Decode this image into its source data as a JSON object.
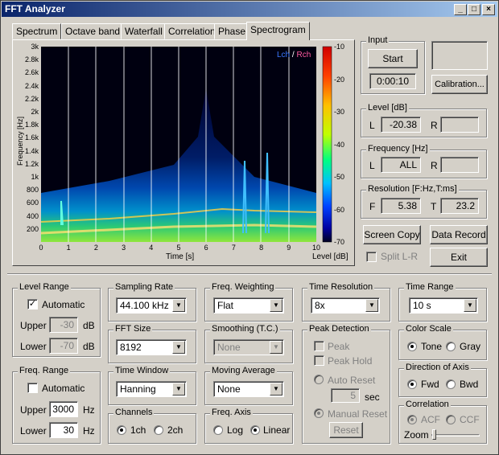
{
  "window": {
    "title": "FFT Analyzer",
    "controls": [
      "_",
      "□",
      "×"
    ]
  },
  "tabs": [
    "Spectrum",
    "Octave band",
    "Waterfall",
    "Correlation",
    "Phase",
    "Spectrogram"
  ],
  "active_tab": "Spectrogram",
  "spectrogram": {
    "y_ticks": [
      "3k",
      "2.8k",
      "2.6k",
      "2.4k",
      "2.2k",
      "2k",
      "1.8k",
      "1.6k",
      "1.4k",
      "1.2k",
      "1k",
      "800",
      "600",
      "400",
      "200"
    ],
    "x_ticks": [
      "0",
      "1",
      "2",
      "3",
      "4",
      "5",
      "6",
      "7",
      "8",
      "9",
      "10"
    ],
    "xlabel": "Time [s]",
    "ylabel": "Frequency [Hz]",
    "legend_lch": "Lch",
    "legend_sep": "/",
    "legend_rch": "Rch",
    "colorbar_ticks": [
      "-10",
      "-20",
      "-30",
      "-40",
      "-50",
      "-60",
      "-70"
    ],
    "colorbar_label": "Level [dB]",
    "colors": {
      "lch": "#3c78ff",
      "rch": "#ff5aa0",
      "background": "#000010"
    }
  },
  "input": {
    "label": "Input",
    "start": "Start",
    "elapsed": "0:00:10",
    "calibration": "Calibration..."
  },
  "level": {
    "label": "Level [dB]",
    "l_label": "L",
    "l_value": "-20.38",
    "r_label": "R",
    "r_value": ""
  },
  "frequency": {
    "label": "Frequency [Hz]",
    "l_label": "L",
    "l_value": "ALL",
    "r_label": "R",
    "r_value": ""
  },
  "resolution": {
    "label": "Resolution [F:Hz,T:ms]",
    "f_label": "F",
    "f_value": "5.38",
    "t_label": "T",
    "t_value": "23.2"
  },
  "buttons": {
    "screen_copy": "Screen Copy",
    "data_record": "Data Record",
    "split": "Split L-R",
    "exit": "Exit"
  },
  "level_range": {
    "label": "Level Range",
    "automatic": "Automatic",
    "automatic_checked": true,
    "upper_label": "Upper",
    "upper": "-30",
    "lower_label": "Lower",
    "lower": "-70",
    "unit": "dB"
  },
  "freq_range": {
    "label": "Freq. Range",
    "automatic": "Automatic",
    "automatic_checked": false,
    "upper_label": "Upper",
    "upper": "3000",
    "lower_label": "Lower",
    "lower": "30",
    "unit": "Hz"
  },
  "sampling_rate": {
    "label": "Sampling Rate",
    "value": "44.100 kHz"
  },
  "fft_size": {
    "label": "FFT Size",
    "value": "8192"
  },
  "time_window": {
    "label": "Time Window",
    "value": "Hanning"
  },
  "channels": {
    "label": "Channels",
    "opt1": "1ch",
    "opt2": "2ch",
    "selected": "1ch"
  },
  "freq_weighting": {
    "label": "Freq. Weighting",
    "value": "Flat"
  },
  "smoothing": {
    "label": "Smoothing (T.C.)",
    "value": "None"
  },
  "moving_average": {
    "label": "Moving Average",
    "value": "None"
  },
  "freq_axis": {
    "label": "Freq. Axis",
    "opt1": "Log",
    "opt2": "Linear",
    "selected": "Linear"
  },
  "time_resolution": {
    "label": "Time Resolution",
    "value": "8x"
  },
  "peak_detection": {
    "label": "Peak Detection",
    "peak": "Peak",
    "peak_hold": "Peak Hold",
    "auto_reset": "Auto Reset",
    "seconds": "5",
    "sec_unit": "sec",
    "manual_reset": "Manual Reset",
    "reset": "Reset"
  },
  "time_range": {
    "label": "Time Range",
    "value": "10 s"
  },
  "color_scale": {
    "label": "Color Scale",
    "opt1": "Tone",
    "opt2": "Gray",
    "selected": "Tone"
  },
  "direction": {
    "label": "Direction of Axis",
    "opt1": "Fwd",
    "opt2": "Bwd",
    "selected": "Fwd"
  },
  "correlation": {
    "label": "Correlation",
    "opt1": "ACF",
    "opt2": "CCF",
    "selected": "ACF",
    "zoom": "Zoom"
  }
}
